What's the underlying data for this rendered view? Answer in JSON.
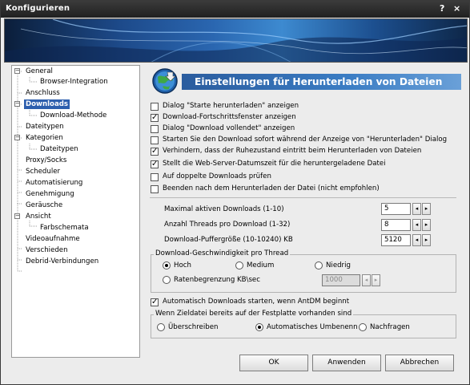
{
  "window": {
    "title": "Konfigurieren",
    "help_label": "?",
    "close_label": "×"
  },
  "sidebar": {
    "items": [
      {
        "label": "General"
      },
      {
        "label": "Browser-Integration"
      },
      {
        "label": "Anschluss"
      },
      {
        "label": "Downloads"
      },
      {
        "label": "Download-Methode"
      },
      {
        "label": "Dateitypen"
      },
      {
        "label": "Kategorien"
      },
      {
        "label": "Dateitypen"
      },
      {
        "label": "Proxy/Socks"
      },
      {
        "label": "Scheduler"
      },
      {
        "label": "Automatisierung"
      },
      {
        "label": "Genehmigung"
      },
      {
        "label": "Geräusche"
      },
      {
        "label": "Ansicht"
      },
      {
        "label": "Farbschemata"
      },
      {
        "label": "Videoaufnahme"
      },
      {
        "label": "Verschieden"
      },
      {
        "label": "Debrid-Verbindungen"
      }
    ],
    "selected": "Downloads"
  },
  "page": {
    "title": "Einstellungen für Herunterladen von Dateien",
    "checkboxes": [
      {
        "label": "Dialog \"Starte herunterladen\" anzeigen",
        "checked": false
      },
      {
        "label": "Download-Fortschrittsfenster anzeigen",
        "checked": true
      },
      {
        "label": "Dialog \"Download vollendet\" anzeigen",
        "checked": false
      },
      {
        "label": "Starten Sie den Download sofort während der Anzeige von \"Herunterladen\" Dialog",
        "checked": false
      },
      {
        "label": "Verhindern, dass der Ruhezustand eintritt beim Herunterladen von Dateien",
        "checked": true
      },
      {
        "label": "Stellt die Web-Server-Datumszeit für die heruntergeladene Datei",
        "checked": true
      },
      {
        "label": "Auf doppelte Downloads prüfen",
        "checked": false
      },
      {
        "label": "Beenden nach dem Herunterladen der Datei (nicht empfohlen)",
        "checked": false
      }
    ],
    "spinners": [
      {
        "label": "Maximal aktiven Downloads (1-10)",
        "value": "5"
      },
      {
        "label": "Anzahl Threads pro Download (1-32)",
        "value": "8"
      },
      {
        "label": "Download-Puffergröße (10-10240) KB",
        "value": "5120"
      }
    ],
    "speed_group": {
      "legend": "Download-Geschwindigkeit pro Thread",
      "options": [
        {
          "label": "Hoch",
          "selected": true
        },
        {
          "label": "Medium",
          "selected": false
        },
        {
          "label": "Niedrig",
          "selected": false
        }
      ],
      "limit_label": "Ratenbegrenzung KB\\sec",
      "limit_selected": false,
      "limit_value": "1000"
    },
    "auto_start": {
      "label": "Automatisch Downloads starten, wenn AntDM beginnt",
      "checked": true
    },
    "exists_group": {
      "legend": "Wenn Zieldatei bereits auf der Festplatte vorhanden sind",
      "options": [
        {
          "label": "Überschreiben",
          "selected": false
        },
        {
          "label": "Automatisches Umbenenn",
          "selected": true
        },
        {
          "label": "Nachfragen",
          "selected": false
        }
      ]
    }
  },
  "footer": {
    "ok_label": "OK",
    "apply_label": "Anwenden",
    "cancel_label": "Abbrechen"
  }
}
